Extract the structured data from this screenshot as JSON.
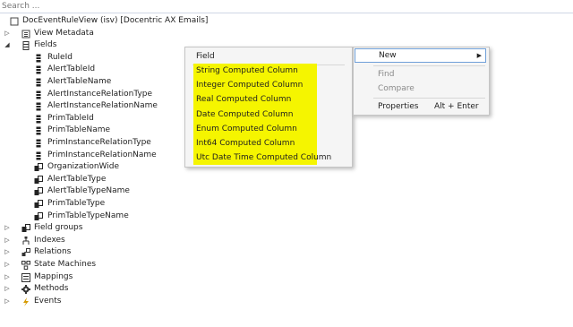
{
  "search": {
    "placeholder": "Search ..."
  },
  "tree": {
    "root": "DocEventRuleView (isv) [Docentric AX Emails]",
    "view_metadata": "View Metadata",
    "fields_label": "Fields",
    "fields": [
      "RuleId",
      "AlertTableId",
      "AlertTableName",
      "AlertInstanceRelationType",
      "AlertInstanceRelationName",
      "PrimTableId",
      "PrimTableName",
      "PrimInstanceRelationType",
      "PrimInstanceRelationName",
      "OrganizationWide",
      "AlertTableType",
      "AlertTableTypeName",
      "PrimTableType",
      "PrimTableTypeName"
    ],
    "nodes": [
      "Field groups",
      "Indexes",
      "Relations",
      "State Machines",
      "Mappings",
      "Methods",
      "Events"
    ]
  },
  "submenu": {
    "header": "Field",
    "items": [
      "String Computed Column",
      "Integer Computed Column",
      "Real Computed Column",
      "Date Computed Column",
      "Enum Computed Column",
      "Int64 Computed Column",
      "Utc Date Time Computed Column"
    ],
    "highlight_color": "#f5f500"
  },
  "context_menu": {
    "new": "New",
    "find": "Find",
    "compare": "Compare",
    "properties": "Properties",
    "properties_shortcut": "Alt + Enter"
  }
}
